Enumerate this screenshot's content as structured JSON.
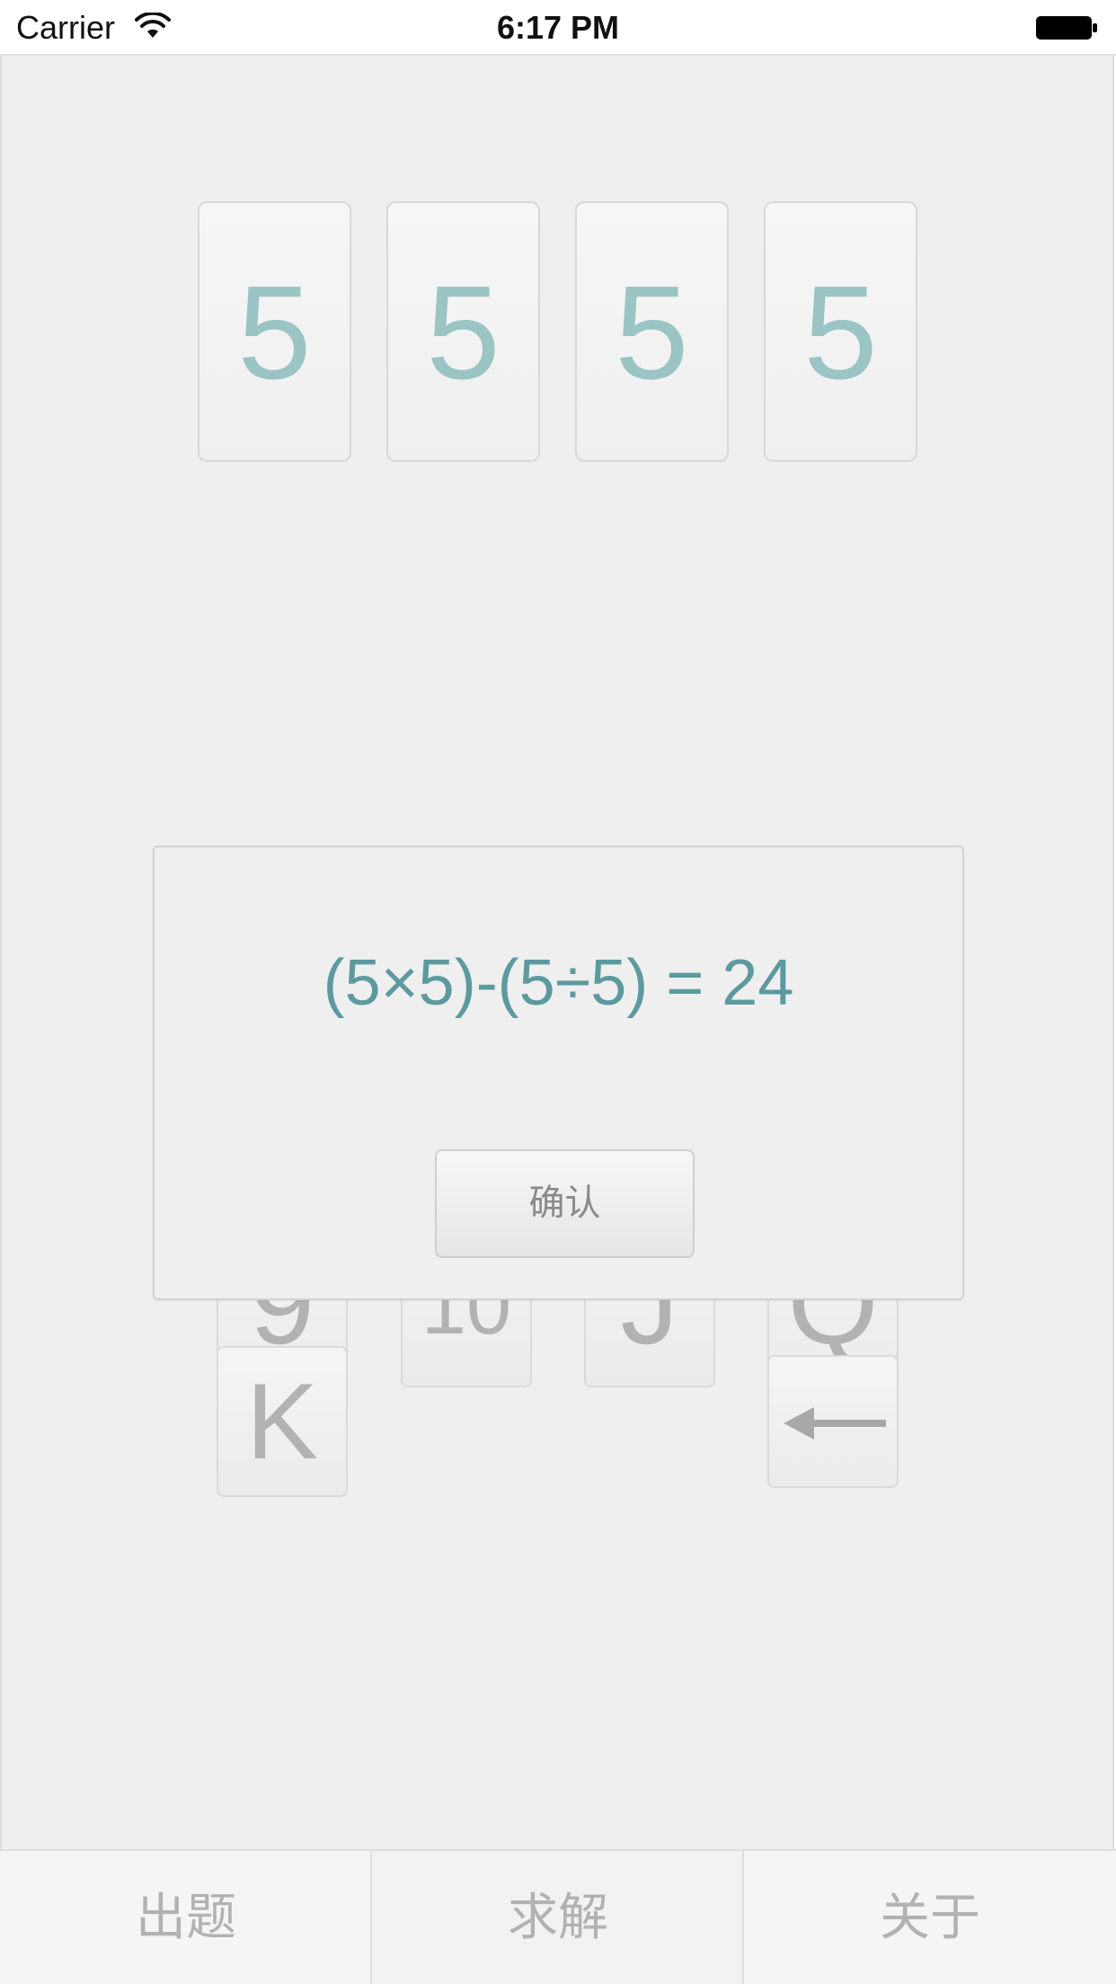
{
  "status_bar": {
    "carrier": "Carrier",
    "time": "6:17 PM",
    "wifi_icon": "wifi-icon",
    "battery_icon": "battery-icon"
  },
  "cards": [
    {
      "value": "5"
    },
    {
      "value": "5"
    },
    {
      "value": "5"
    },
    {
      "value": "5"
    }
  ],
  "keypad": {
    "keys": [
      "9",
      "10",
      "J",
      "Q",
      "K"
    ],
    "backspace_icon": "left-arrow-icon"
  },
  "dialog": {
    "solution": "(5×5)-(5÷5) = 24",
    "confirm_label": "确认"
  },
  "tab_bar": {
    "tabs": [
      {
        "label": "出题"
      },
      {
        "label": "求解"
      },
      {
        "label": "关于"
      }
    ],
    "active_index": 1
  },
  "colors": {
    "card_digit": "#9bc4c4",
    "solution_text": "#5c9a9f",
    "background": "#efefef",
    "muted_text": "#b2b2b2"
  }
}
